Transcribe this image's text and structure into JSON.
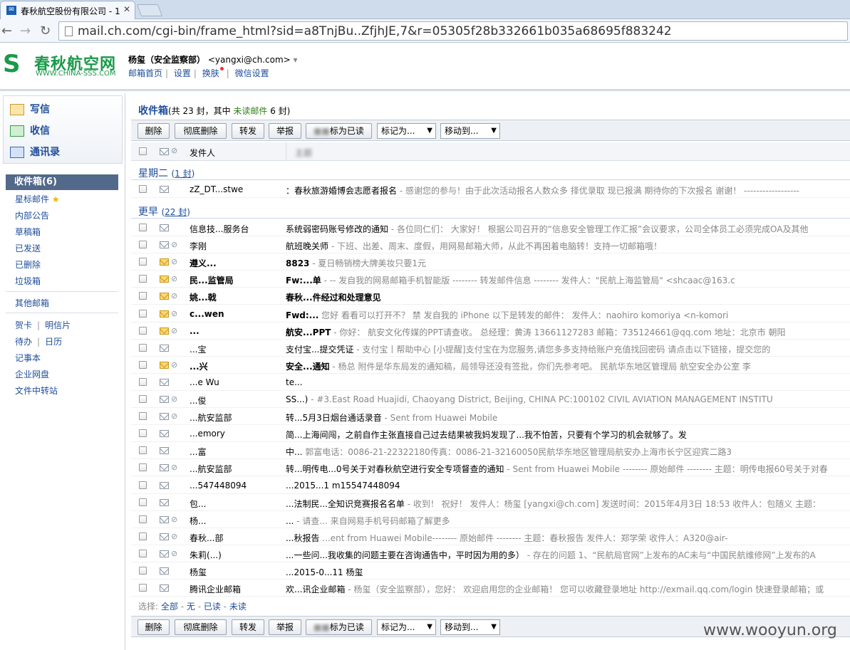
{
  "browser": {
    "tab_title": "春秋航空股份有限公司 - 1",
    "url": "mail.ch.com/cgi-bin/frame_html?sid=a8TnjBu..ZfjhJE,7&r=05305f28b332661b035a68695f883242"
  },
  "header": {
    "logo_text": "春秋航空网",
    "logo_sub": "WWW.CHINA-SSS.COM",
    "user_name": "杨玺（安全监察部）",
    "user_email": "<yangxi@ch.com>",
    "links": [
      "邮箱首页",
      "设置",
      "换肤",
      "微信设置"
    ]
  },
  "sidebar": {
    "compose": "写信",
    "receive": "收信",
    "contacts": "通讯录",
    "inbox": "收件箱(6)",
    "starred": "星标邮件",
    "items1": [
      "内部公告",
      "草稿箱",
      "已发送",
      "已删除",
      "垃圾箱"
    ],
    "other": "其他邮箱",
    "items2": [
      [
        "贺卡",
        "明信片"
      ],
      [
        "待办",
        "日历"
      ]
    ],
    "items3": [
      "记事本",
      "企业网盘",
      "文件中转站"
    ]
  },
  "main": {
    "title": "收件箱",
    "summary_pre": "(共 23 封，其中 ",
    "summary_unread": "未读邮件",
    "summary_post": " 6 封)",
    "toolbar": {
      "delete": "删除",
      "purge": "彻底删除",
      "forward": "转发",
      "report": "举报",
      "mark_read": "标为已读",
      "mark_as": "标记为...",
      "move_to": "移动到..."
    },
    "col_sender": "发件人",
    "col_subject": "主题",
    "groups": [
      {
        "label": "星期二",
        "count": "1 封"
      },
      {
        "label": "更早",
        "count": "22 封"
      }
    ],
    "select_label": "选择:",
    "select_options": [
      "全部",
      "无",
      "已读",
      "未读"
    ]
  },
  "emails": [
    {
      "sender": "zZ_DT...stwe",
      "subject": "：春秋旅游婚博会志愿者报名",
      "preview": " - 感谢您的参与！由于此次活动报名人数众多 择优录取 现已报满 期待你的下次报名 谢谢！ ------------------",
      "unread": false,
      "attach": false
    },
    {
      "sender": "信息技...服务台",
      "subject": "系统弱密码账号修改的通知",
      "preview": " - 各位同仁们： 大家好！ 根据公司召开的“信息安全管理工作汇报”会议要求，公司全体员工必须完成OA及其他",
      "unread": false,
      "attach": false
    },
    {
      "sender": "李刚",
      "subject": "航班晚关师",
      "preview": " - 下班、出差、周末、度假，用网易邮箱大师，从此不再困着电脑转！支持一切邮箱哦！",
      "unread": false,
      "attach": true
    },
    {
      "sender": "遵义...",
      "subject": "8823",
      "preview": " - 夏日畅销榜大牌美妆只要1元",
      "unread": true,
      "attach": true
    },
    {
      "sender": "民...监管局",
      "subject": "Fw:...单",
      "preview": " - -- 发自我的网易邮箱手机智能版 -------- 转发邮件信息 -------- 发件人：\"民航上海监管局\" <shcaac@163.c",
      "unread": true,
      "attach": true
    },
    {
      "sender": "姚...戟",
      "subject": "春秋...件经过和处理意见",
      "preview": "",
      "unread": true,
      "attach": true
    },
    {
      "sender": "c...wen",
      "subject": "Fwd:...",
      "preview": " 您好 看看可以打开不？ 禁 发自我的 iPhone 以下是转发的邮件： 发件人：naohiro komoriya <n-komori",
      "unread": true,
      "attach": true
    },
    {
      "sender": "...",
      "subject": "航安...PPT",
      "preview": " - 你好： 航安文化传媒的PPT请查收。 总经理：黄涛 13661127283 邮箱：735124661@qq.com 地址：北京市 朝阳",
      "unread": true,
      "attach": true
    },
    {
      "sender": "...宝",
      "subject": "支付宝...提交凭证",
      "preview": " - 支付宝丨帮助中心 [小提醒]支付宝在为您服务,请您多多支持给账户充值找回密码 请点击以下链接，提交您的",
      "unread": false,
      "attach": false
    },
    {
      "sender": "...兴",
      "subject": "安全...通知",
      "preview": " - 杨总 附件是华东局发的通知稿，局领导还没有签批，你们先参考吧。 民航华东地区管理局 航空安全办公室 李",
      "unread": true,
      "attach": true
    },
    {
      "sender": "...e Wu",
      "subject": "te...",
      "preview": "",
      "unread": false,
      "attach": false
    },
    {
      "sender": "...俊",
      "subject": "SS...)",
      "preview": " - #3.East Road Huajidi, Chaoyang District, Beijing, CHINA PC:100102 CIVIL AVIATION MANAGEMENT INSTITU",
      "unread": false,
      "attach": true
    },
    {
      "sender": "...航安监部",
      "subject": "转...5月3日烟台通话录音",
      "preview": " - Sent from Huawei Mobile",
      "unread": false,
      "attach": true
    },
    {
      "sender": "...emory",
      "subject": "简...上海间闯，之前自作主张直接自己过去结果被我妈发现了...我不怕苦，只要有个学习的机会就够了。发",
      "preview": "",
      "unread": false,
      "attach": false
    },
    {
      "sender": "...富",
      "subject": "中...",
      "preview": " 郭富电话：0086-21-22322180传真：0086-21-32160050民航华东地区管理局航安办上海市长宁区迎宾二路3",
      "unread": false,
      "attach": false
    },
    {
      "sender": "...航安监部",
      "subject": "转...明传电...0号关于对春秋航空进行安全专项督查的通知",
      "preview": " - Sent from Huawei Mobile -------- 原始邮件 -------- 主题：明传电报60号关于对春",
      "unread": false,
      "attach": true
    },
    {
      "sender": "...547448094",
      "subject": "...2015...1 m15547448094",
      "preview": "",
      "unread": false,
      "attach": false
    },
    {
      "sender": "包...",
      "subject": "...法制民...全知识竞赛报名名单",
      "preview": " - 收到！ 祝好！ 发件人：杨玺 [yangxi@ch.com] 发送时间：2015年4月3日 18:53 收件人：包随义 主题：",
      "unread": false,
      "attach": false
    },
    {
      "sender": "杨...",
      "subject": "...",
      "preview": " - 请查... 来自网易手机号码邮箱了解更多",
      "unread": false,
      "attach": true
    },
    {
      "sender": "春秋...部",
      "subject": "...秋报告",
      "preview": " ...ent from Huawei Mobile-------- 原始邮件 -------- 主题：春秋报告 发件人：郑学荣 收件人：A320@air-",
      "unread": false,
      "attach": true
    },
    {
      "sender": "朱莉(...)",
      "subject": "...一些问...我收集的问题主要在咨询通告中，平时因为用的多）",
      "preview": " - 存在的问题 1、“民航局官网”上发布的AC未与“中国民航维修网”上发布的A",
      "unread": false,
      "attach": true
    },
    {
      "sender": "杨玺",
      "subject": "...2015-0...11 杨玺",
      "preview": "",
      "unread": false,
      "attach": false
    },
    {
      "sender": "腾讯企业邮箱",
      "subject": "欢...讯企业邮箱",
      "preview": " - 杨玺（安全监察部），您好： 欢迎启用您的企业邮箱！ 您可以收藏登录地址 http://exmail.qq.com/login 快速登录邮箱；或",
      "unread": false,
      "attach": false
    }
  ],
  "watermark": "www.wooyun.org"
}
